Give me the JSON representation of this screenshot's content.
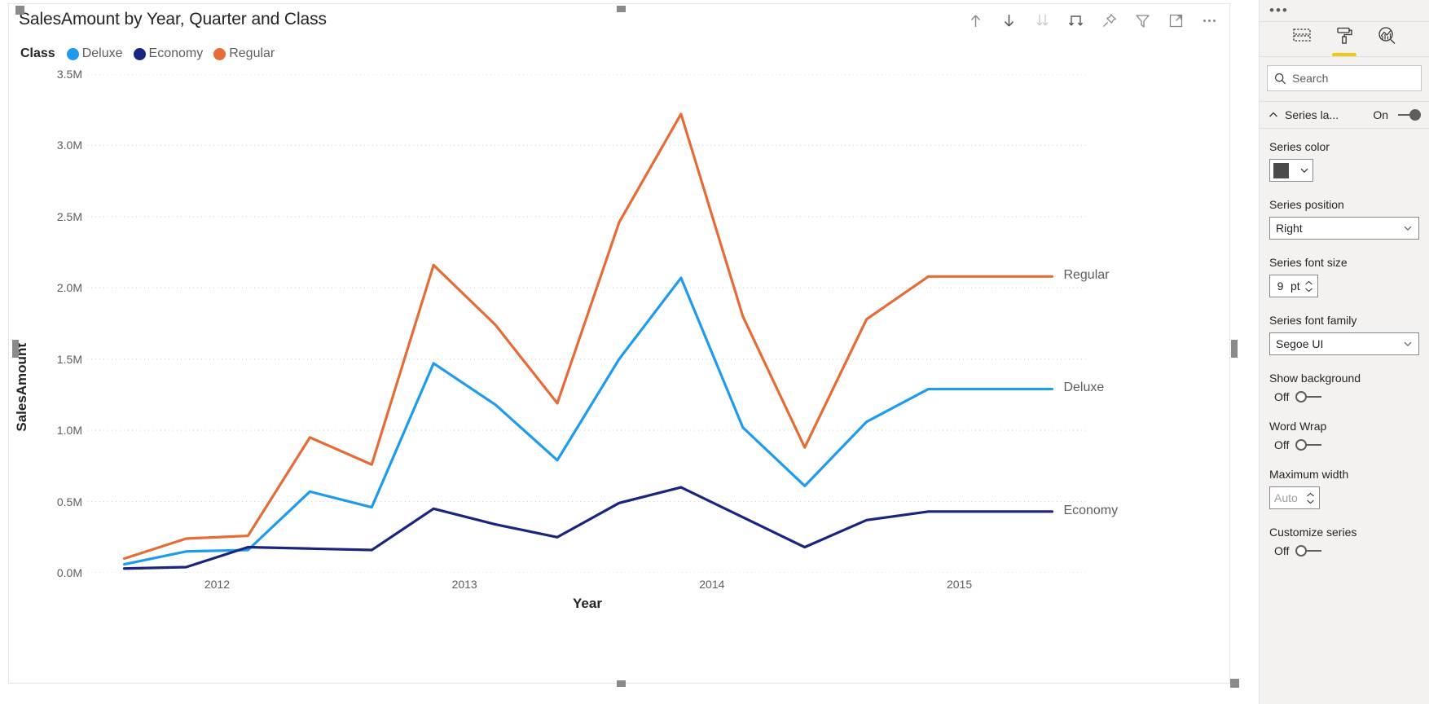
{
  "visual": {
    "title": "SalesAmount by Year, Quarter and Class",
    "legend_title": "Class",
    "toolbar": [
      {
        "name": "drill-up-icon",
        "label": "Drill up"
      },
      {
        "name": "drill-down-icon",
        "label": "Drill down"
      },
      {
        "name": "go-to-next-level-icon",
        "label": "Go to the next level in the hierarchy"
      },
      {
        "name": "expand-all-down-icon",
        "label": "Expand all down one level in the hierarchy"
      },
      {
        "name": "pin-icon",
        "label": "Pin visual"
      },
      {
        "name": "filter-icon",
        "label": "Filters"
      },
      {
        "name": "focus-mode-icon",
        "label": "Focus mode"
      },
      {
        "name": "more-options-icon",
        "label": "More options"
      }
    ]
  },
  "chart_data": {
    "type": "line",
    "title": "SalesAmount by Year, Quarter and Class",
    "xlabel": "Year",
    "ylabel": "SalesAmount",
    "grid": true,
    "legend_position": "top",
    "series_labels_position": "right",
    "ylim": [
      0,
      3500000
    ],
    "ytick_labels": [
      "0.0M",
      "0.5M",
      "1.0M",
      "1.5M",
      "2.0M",
      "2.5M",
      "3.0M",
      "3.5M"
    ],
    "ytick_values": [
      0,
      500000,
      1000000,
      1500000,
      2000000,
      2500000,
      3000000,
      3500000
    ],
    "xtick_labels": [
      "2012",
      "2013",
      "2014",
      "2015"
    ],
    "x": [
      "2012 Q1",
      "2012 Q2",
      "2012 Q3",
      "2012 Q4",
      "2013 Q1",
      "2013 Q2",
      "2013 Q3",
      "2013 Q4",
      "2014 Q1",
      "2014 Q2",
      "2014 Q3",
      "2014 Q4",
      "2015 Q1",
      "2015 Q2",
      "2015 Q3",
      "2015 Q4"
    ],
    "series": [
      {
        "name": "Deluxe",
        "color": "#1E9BEE",
        "end_label": "Deluxe",
        "values": [
          60000,
          150000,
          160000,
          570000,
          460000,
          1470000,
          1180000,
          790000,
          1500000,
          2070000,
          1020000,
          610000,
          1060000,
          1290000,
          1290000,
          1290000
        ]
      },
      {
        "name": "Economy",
        "color": "#19257F",
        "end_label": "Economy",
        "values": [
          30000,
          40000,
          180000,
          170000,
          160000,
          450000,
          340000,
          250000,
          490000,
          600000,
          390000,
          180000,
          370000,
          430000,
          430000,
          430000
        ]
      },
      {
        "name": "Regular",
        "color": "#E66B36",
        "end_label": "Regular",
        "values": [
          100000,
          240000,
          260000,
          950000,
          760000,
          2160000,
          1740000,
          1190000,
          2460000,
          3220000,
          1800000,
          880000,
          1780000,
          2080000,
          2080000,
          2080000
        ]
      }
    ]
  },
  "format_pane": {
    "overflow_dots": "•••",
    "tabs": [
      {
        "name": "fields-tab",
        "icon": "table-fields-icon",
        "active": false
      },
      {
        "name": "format-tab",
        "icon": "paint-roller-icon",
        "active": true
      },
      {
        "name": "analytics-tab",
        "icon": "analytics-magnifier-icon",
        "active": false
      }
    ],
    "search_placeholder": "Search",
    "card": {
      "title": "Series la...",
      "toggle_state": "On",
      "toggle_on": true
    },
    "properties": [
      {
        "name": "series-color",
        "label": "Series color",
        "control": "color",
        "value": "#4a4a4a"
      },
      {
        "name": "series-position",
        "label": "Series position",
        "control": "select",
        "value": "Right"
      },
      {
        "name": "series-font-size",
        "label": "Series font size",
        "control": "spinner",
        "value": "9",
        "unit": "pt"
      },
      {
        "name": "series-font-family",
        "label": "Series font family",
        "control": "select",
        "value": "Segoe UI"
      },
      {
        "name": "show-background",
        "label": "Show background",
        "control": "toggle",
        "value": "Off"
      },
      {
        "name": "word-wrap",
        "label": "Word Wrap",
        "control": "toggle",
        "value": "Off"
      },
      {
        "name": "maximum-width",
        "label": "Maximum width",
        "control": "spinner-auto",
        "value": "Auto"
      },
      {
        "name": "customize-series",
        "label": "Customize series",
        "control": "toggle",
        "value": "Off"
      }
    ]
  }
}
